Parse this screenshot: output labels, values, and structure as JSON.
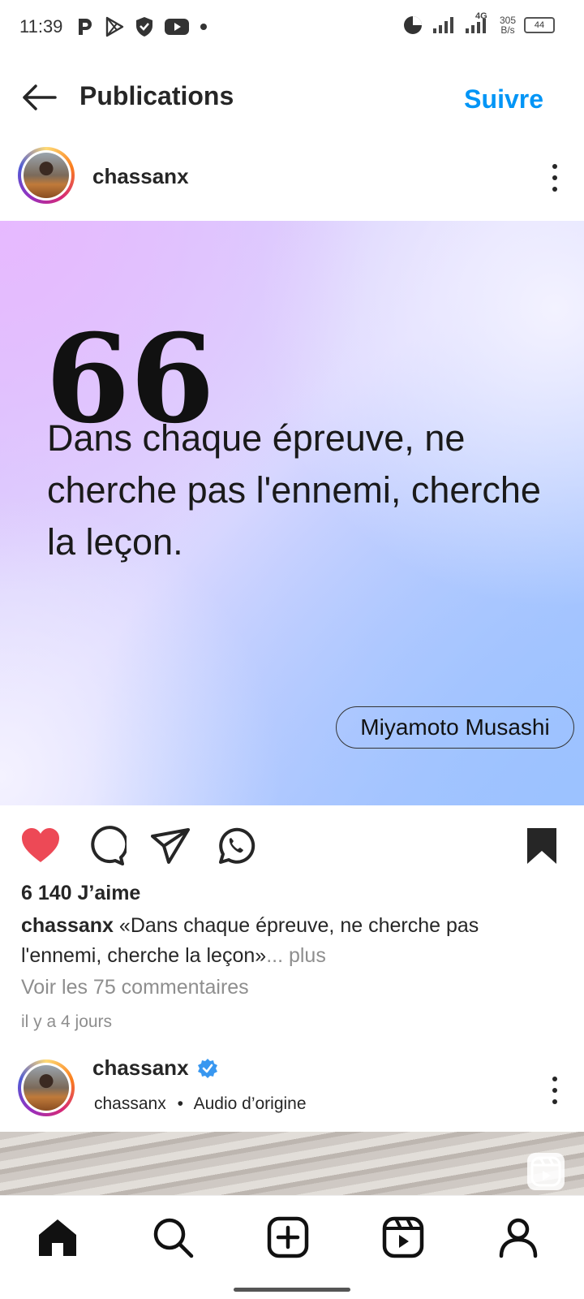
{
  "status_bar": {
    "time": "11:39",
    "network": "4G",
    "speed_top": "305",
    "speed_bottom": "B/s",
    "battery": "44"
  },
  "header": {
    "title": "Publications",
    "follow_label": "Suivre"
  },
  "post": {
    "username": "chassanx",
    "image": {
      "quote_mark": "66",
      "quote_text": "Dans chaque épreuve, ne cherche pas l'ennemi, cherche la leçon.",
      "author": "Miyamoto Musashi"
    },
    "likes": "6 140 J’aime",
    "caption_user": "chassanx",
    "caption_text": " «Dans chaque épreuve, ne cherche pas l'ennemi, cherche la leçon»",
    "caption_more": "... plus",
    "comments_link": "Voir les 75 commentaires",
    "date": "il y a 4 jours",
    "liked": true,
    "saved": true
  },
  "next_post": {
    "username": "chassanx",
    "sub_user": "chassanx",
    "separator": "•",
    "audio": "Audio d’origine"
  },
  "colors": {
    "accent": "#0095f6",
    "like": "#ed4956",
    "verified": "#3897f0"
  },
  "nav": [
    "home-icon",
    "search-icon",
    "create-icon",
    "reels-icon",
    "profile-icon"
  ]
}
